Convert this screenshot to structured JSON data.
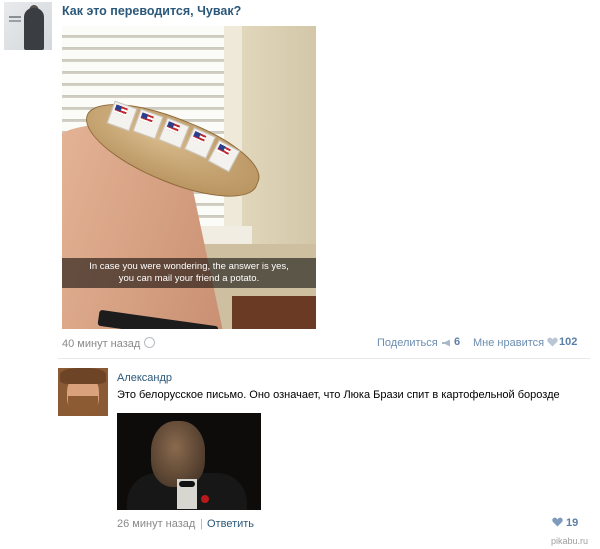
{
  "post": {
    "title": "Как это переводится, Чувак?",
    "photo_caption_line1": "In case you were wondering, the answer is yes,",
    "photo_caption_line2": "you can mail your friend a potato.",
    "time": "40 минут назад",
    "share_label": "Поделиться",
    "share_count": "6",
    "like_label": "Мне нравится",
    "like_count": "102"
  },
  "comment": {
    "author": "Александр",
    "text": "Это белорусское письмо. Оно означает, что Люка Брази спит в картофельной борозде",
    "time": "26 минут назад",
    "separator": "|",
    "reply_label": "Ответить",
    "like_count": "19"
  },
  "watermark": "pikabu.ru",
  "colors": {
    "link": "#2b587a",
    "muted": "#8a8a8a",
    "accent": "#5b7fa6"
  },
  "icons": [
    "clock-icon",
    "megaphone-icon",
    "heart-icon"
  ]
}
